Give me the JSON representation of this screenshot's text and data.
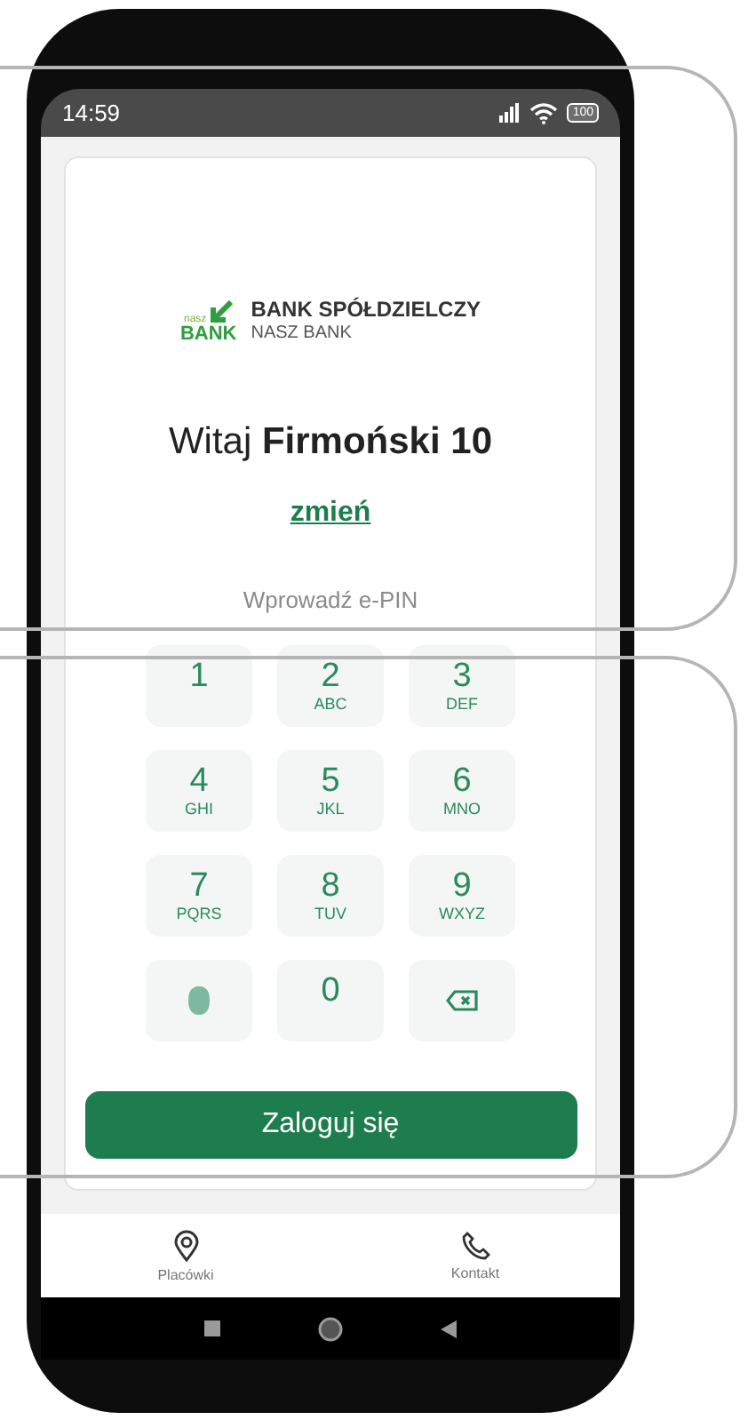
{
  "status_bar": {
    "time": "14:59",
    "battery": "100"
  },
  "logo": {
    "small": "nasz",
    "big": "BANK",
    "title": "BANK SPÓŁDZIELCZY",
    "subtitle": "NASZ BANK"
  },
  "greeting": "Witaj **Firmoński 10**",
  "change_link": "zmień",
  "pin_prompt": "Wprowadź e-PIN",
  "keypad": [
    {
      "kind": "digit",
      "digit": "1"
    },
    {
      "kind": "digit",
      "digit": "2",
      "letters": "ABC"
    },
    {
      "kind": "digit",
      "digit": "3",
      "letters": "DEF"
    },
    {
      "kind": "digit",
      "digit": "4",
      "letters": "GHI"
    },
    {
      "kind": "digit",
      "digit": "5",
      "letters": "JKL"
    },
    {
      "kind": "digit",
      "digit": "6",
      "letters": "MNO"
    },
    {
      "kind": "digit",
      "digit": "7",
      "letters": "PQRS"
    },
    {
      "kind": "digit",
      "digit": "8",
      "letters": "TUV"
    },
    {
      "kind": "digit",
      "digit": "9",
      "letters": "WXYZ"
    },
    {
      "kind": "fingerprint"
    },
    {
      "kind": "digit",
      "digit": "0"
    },
    {
      "kind": "backspace"
    }
  ],
  "login_button": "Zaloguj się",
  "bottom_nav": [
    {
      "kind": "location",
      "label": "Placówki"
    },
    {
      "kind": "phone",
      "label": "Kontakt"
    }
  ]
}
